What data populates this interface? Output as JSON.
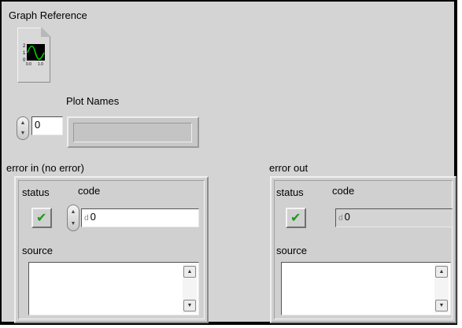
{
  "graph_reference": {
    "label": "Graph Reference",
    "icon": "waveform-graph-icon"
  },
  "plot_names": {
    "label": "Plot Names",
    "index_value": "0",
    "value": ""
  },
  "error_in": {
    "label": "error in (no error)",
    "status_label": "status",
    "code_label": "code",
    "code_value": "0",
    "code_type_tag": "d",
    "source_label": "source",
    "source_value": ""
  },
  "error_out": {
    "label": "error out",
    "status_label": "status",
    "code_label": "code",
    "code_value": "0",
    "code_type_tag": "d",
    "source_label": "source",
    "source_value": ""
  },
  "colors": {
    "panel": "#d4d4d4",
    "status_ok": "#1a9a1a",
    "graph_bg": "#000000",
    "graph_trace": "#00d000"
  }
}
